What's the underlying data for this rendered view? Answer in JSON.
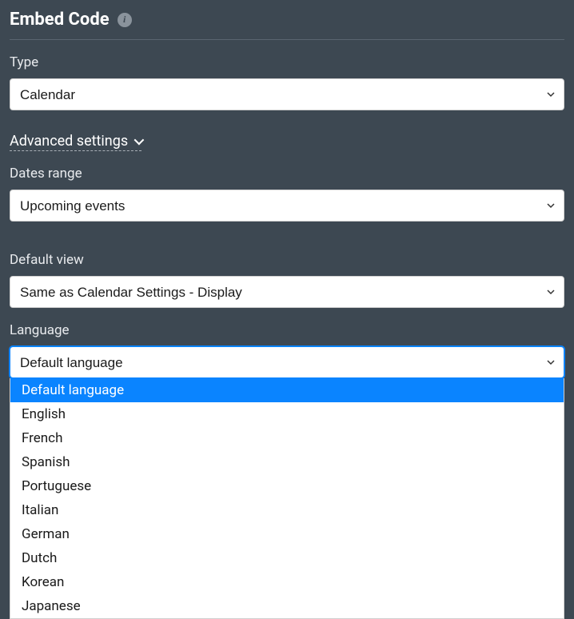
{
  "header": {
    "title": "Embed Code"
  },
  "fields": {
    "type": {
      "label": "Type",
      "value": "Calendar"
    },
    "advanced_toggle": "Advanced settings",
    "dates_range": {
      "label": "Dates range",
      "value": "Upcoming events"
    },
    "default_view": {
      "label": "Default view",
      "value": "Same as Calendar Settings - Display"
    },
    "language": {
      "label": "Language",
      "value": "Default language",
      "options": [
        "Default language",
        "English",
        "French",
        "Spanish",
        "Portuguese",
        "Italian",
        "German",
        "Dutch",
        "Korean",
        "Japanese"
      ]
    }
  }
}
